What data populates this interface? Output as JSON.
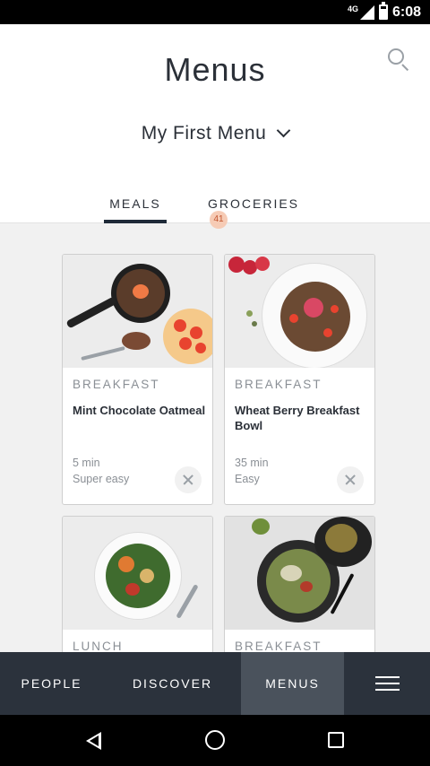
{
  "status_bar": {
    "network": "4G",
    "time": "6:08"
  },
  "header": {
    "title": "Menus",
    "menu_name": "My First Menu"
  },
  "tabs": [
    {
      "label": "MEALS",
      "active": true
    },
    {
      "label": "GROCERIES",
      "badge": "41",
      "active": false
    }
  ],
  "cards": [
    {
      "category": "BREAKFAST",
      "name": "Mint Chocolate Oatmeal",
      "time": "5 min",
      "difficulty": "Super easy"
    },
    {
      "category": "BREAKFAST",
      "name": "Wheat Berry Breakfast Bowl",
      "time": "35 min",
      "difficulty": "Easy"
    },
    {
      "category": "LUNCH",
      "name": "",
      "time": "",
      "difficulty": ""
    },
    {
      "category": "BREAKFAST",
      "name": "",
      "time": "",
      "difficulty": ""
    }
  ],
  "bottom_nav": {
    "items": [
      {
        "label": "PEOPLE",
        "active": false
      },
      {
        "label": "DISCOVER",
        "active": false
      },
      {
        "label": "MENUS",
        "active": true
      }
    ],
    "more_icon": "hamburger-menu-icon"
  },
  "colors": {
    "nav_background": "#2b323c",
    "nav_active": "#4a525c",
    "badge_background": "#f6cbb5",
    "badge_text": "#c2552f",
    "tab_underline": "#1f2a38"
  }
}
